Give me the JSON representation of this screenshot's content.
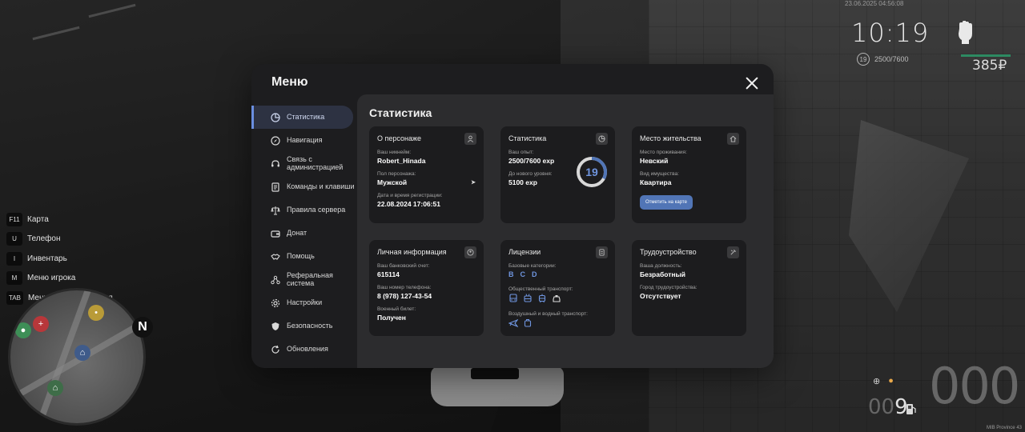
{
  "hud": {
    "datetime": "23.06.2025 04:56:08",
    "clock": "10:19",
    "level": "19",
    "exp": "2500/7600",
    "money": "385₽",
    "hotkeys": [
      {
        "key": "F11",
        "label": "Карта"
      },
      {
        "key": "U",
        "label": "Телефон"
      },
      {
        "key": "I",
        "label": "Инвентарь"
      },
      {
        "key": "M",
        "label": "Меню игрока"
      },
      {
        "key": "TAB",
        "label": "Меню взаимодействия"
      }
    ],
    "compass": "N",
    "fuel_dim": "00",
    "fuel_value": "9",
    "speed": "000",
    "watermark": "MIB Province 43"
  },
  "menu": {
    "title": "Меню",
    "nav": [
      {
        "label": "Статистика",
        "icon": "pie-chart-icon"
      },
      {
        "label": "Навигация",
        "icon": "compass-icon"
      },
      {
        "label": "Связь с администрацией",
        "icon": "headset-icon"
      },
      {
        "label": "Команды и клавиши",
        "icon": "document-icon"
      },
      {
        "label": "Правила сервера",
        "icon": "scales-icon"
      },
      {
        "label": "Донат",
        "icon": "wallet-icon"
      },
      {
        "label": "Помощь",
        "icon": "handshake-icon"
      },
      {
        "label": "Реферальная система",
        "icon": "network-icon"
      },
      {
        "label": "Настройки",
        "icon": "gear-icon"
      },
      {
        "label": "Безопасность",
        "icon": "shield-icon"
      },
      {
        "label": "Обновления",
        "icon": "refresh-icon"
      }
    ]
  },
  "stats": {
    "title": "Статистика",
    "character": {
      "title": "О персонаже",
      "nick_label": "Ваш никнейм:",
      "nick": "Robert_Hinada",
      "gender_label": "Пол персонажа:",
      "gender": "Мужской",
      "reg_label": "Дата и время регистрации:",
      "reg": "22.08.2024 17:06:51"
    },
    "progress": {
      "title": "Статистика",
      "exp_label": "Ваш опыт:",
      "exp": "2500/7600 exp",
      "next_label": "До нового уровня:",
      "next": "5100 exp",
      "level": "19",
      "level_progress": 0.33
    },
    "residence": {
      "title": "Место жительства",
      "place_label": "Место проживания:",
      "place": "Невский",
      "property_label": "Вид имущества:",
      "property": "Квартира",
      "button": "Отметить на карте"
    },
    "personal": {
      "title": "Личная информация",
      "bank_label": "Ваш банковский счет:",
      "bank": "615114",
      "phone_label": "Ваш номер телефона:",
      "phone": "8 (978) 127-43-54",
      "military_label": "Военный билет:",
      "military": "Получен"
    },
    "licenses": {
      "title": "Лицензии",
      "basic_label": "Базовые категории:",
      "basic": [
        "B",
        "C",
        "D"
      ],
      "public_label": "Общественный транспорт:",
      "air_label": "Воздушный и водный транспорт:"
    },
    "job": {
      "title": "Трудоустройство",
      "position_label": "Ваша должность:",
      "position": "Безработный",
      "city_label": "Город трудоустройства:",
      "city": "Отсутствует"
    }
  },
  "colors": {
    "accent": "#5175b6",
    "accent_text": "#6f95df",
    "card_bg": "#1c1c1e",
    "panel_bg": "#2c2c2e",
    "menu_bg": "#1d1d1f"
  }
}
